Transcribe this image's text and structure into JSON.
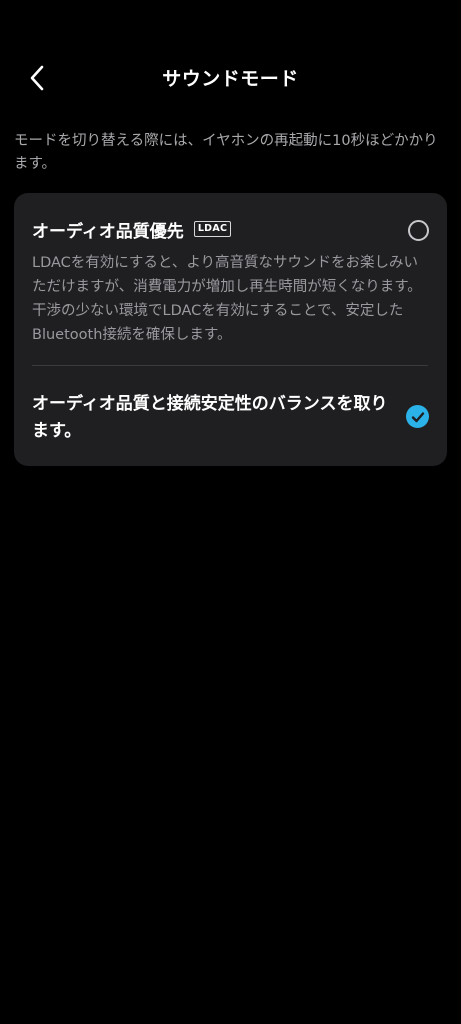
{
  "header": {
    "title": "サウンドモード",
    "back_icon": "chevron-left-icon"
  },
  "description": "モードを切り替える際には、イヤホンの再起動に10秒ほどかかります。",
  "options": [
    {
      "title": "オーディオ品質優先",
      "badge": "LDAC",
      "description": "LDACを有効にすると、より高音質なサウンドをお楽しみいただけますが、消費電力が増加し再生時間が短くなります。干渉の少ない環境でLDACを有効にすることで、安定したBluetooth接続を確保します。",
      "selected": false
    },
    {
      "title": "オーディオ品質と接続安定性のバランスを取ります。",
      "selected": true
    }
  ],
  "colors": {
    "background": "#000000",
    "card": "#1f1f22",
    "accent": "#2bb2e8",
    "secondary_text": "#a9a9ad"
  }
}
